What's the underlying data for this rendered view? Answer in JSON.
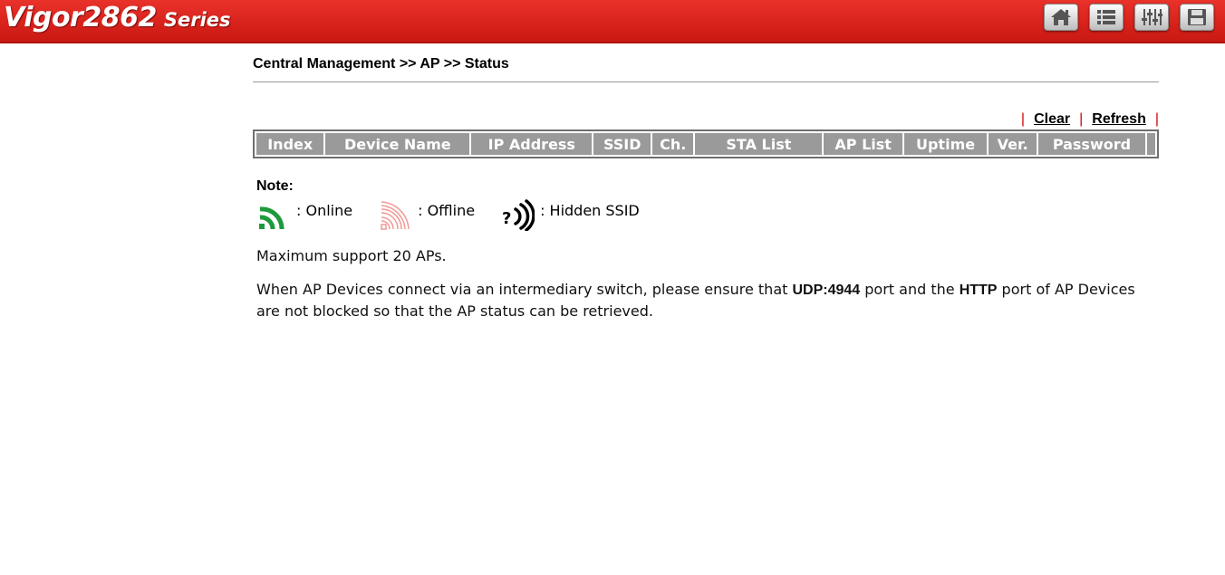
{
  "header": {
    "model": "Vigor2862",
    "series": "Series",
    "toolbar": [
      {
        "name": "home-icon"
      },
      {
        "name": "menu-icon"
      },
      {
        "name": "settings-icon"
      },
      {
        "name": "save-icon"
      }
    ]
  },
  "breadcrumb": "Central Management >> AP >> Status",
  "actions": {
    "clear_label": "Clear",
    "refresh_label": "Refresh"
  },
  "table": {
    "columns": [
      "Index",
      "Device Name",
      "IP Address",
      "SSID",
      "Ch.",
      "STA List",
      "AP List",
      "Uptime",
      "Ver.",
      "Password"
    ],
    "rows": []
  },
  "note": {
    "title": "Note:",
    "legend": [
      {
        "icon": "wifi-online-icon",
        "color": "#1e9a3c",
        "label": ": Online"
      },
      {
        "icon": "wifi-offline-icon",
        "color": "#f09a96",
        "label": ": Offline"
      },
      {
        "icon": "hidden-ssid-icon",
        "color": "#000000",
        "label": ": Hidden SSID"
      }
    ]
  },
  "max_support": "Maximum support 20 APs.",
  "info": {
    "part1": "When AP Devices connect via an intermediary switch, please ensure that ",
    "udp": "UDP:4944",
    "part2": " port and the ",
    "http": "HTTP",
    "part3": " port of AP Devices are not blocked so that the AP status can be retrieved."
  },
  "colors": {
    "header_red": "#d7211b",
    "table_header_gray": "#9a9a9a",
    "separator_red": "#d40000"
  }
}
